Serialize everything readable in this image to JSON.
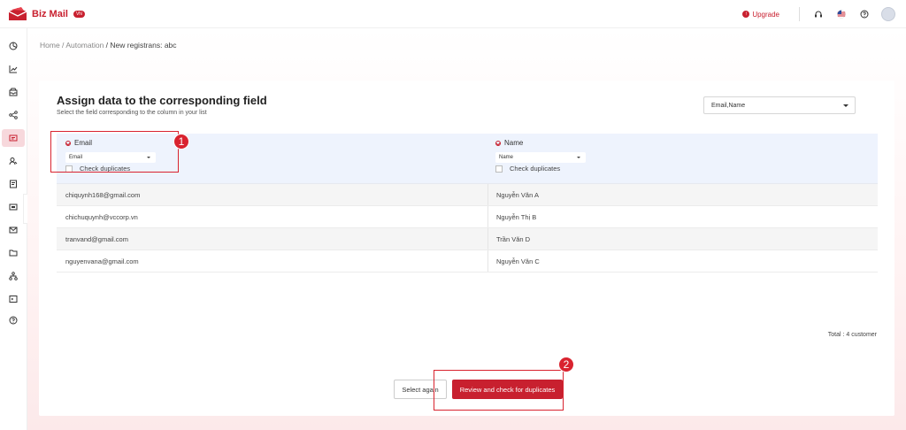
{
  "app": {
    "brand": "Biz Mail",
    "brand_badge": "VN"
  },
  "topbar": {
    "upgrade_label": "Upgrade",
    "icons": [
      "headset-icon",
      "us-flag-icon",
      "help-icon",
      "user-avatar"
    ]
  },
  "sidebar": {
    "items": [
      {
        "icon": "dashboard-icon"
      },
      {
        "icon": "chart-icon"
      },
      {
        "icon": "inbox-icon"
      },
      {
        "icon": "share-icon"
      },
      {
        "icon": "automation-icon",
        "active": true
      },
      {
        "icon": "contacts-icon"
      },
      {
        "icon": "form-icon"
      },
      {
        "icon": "template-icon"
      },
      {
        "icon": "mail-icon"
      },
      {
        "icon": "folder-icon"
      },
      {
        "icon": "network-icon"
      },
      {
        "icon": "terminal-icon"
      },
      {
        "icon": "help-circle-icon"
      }
    ],
    "collapse_glyph": "›"
  },
  "breadcrumb": {
    "home": "Home",
    "sep1": " / ",
    "automation": "Automation",
    "sep2": " / ",
    "current": "New registrans: abc"
  },
  "card": {
    "title": "Assign data to the corresponding field",
    "subtitle": "Select the field corresponding to the column in your list",
    "field_select": "Email,Name"
  },
  "table": {
    "columns": [
      {
        "label": "Email",
        "select_value": "Email",
        "check_label": "Check duplicates"
      },
      {
        "label": "Name",
        "select_value": "Name",
        "check_label": "Check duplicates"
      }
    ],
    "rows": [
      {
        "email": "chiquynh168@gmail.com",
        "name": "Nguyễn Văn A"
      },
      {
        "email": "chichuquynh@vccorp.vn",
        "name": "Nguyễn Thị B"
      },
      {
        "email": "tranvand@gmail.com",
        "name": "Trần Văn D"
      },
      {
        "email": "nguyenvana@gmail.com",
        "name": "Nguyễn Văn C"
      }
    ]
  },
  "total_label": "Total : 4 customer",
  "buttons": {
    "select_again": "Select again",
    "review": "Review and check for duplicates"
  },
  "annotations": {
    "step1": "1",
    "step2": "2"
  },
  "colors": {
    "primary": "#c8202f",
    "header_bg": "#eef3fd",
    "annotation": "#d9232f"
  }
}
